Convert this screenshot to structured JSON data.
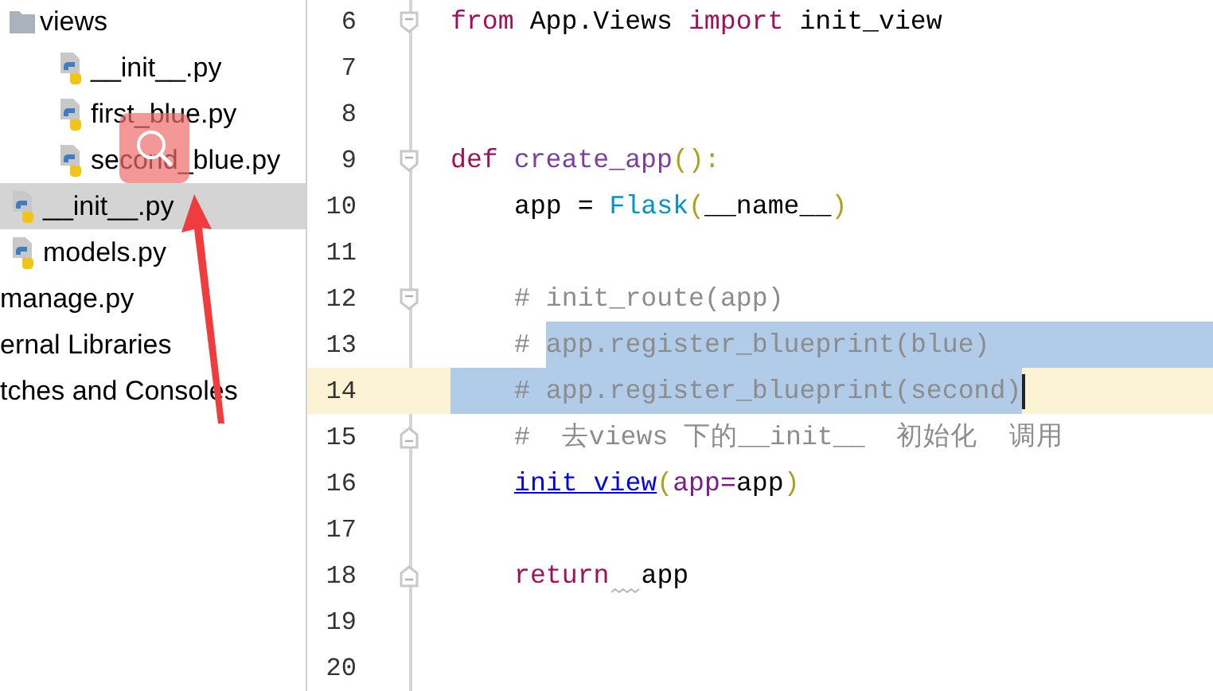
{
  "project_tree": {
    "items": [
      {
        "label": "views",
        "kind": "folder",
        "selected": false,
        "children": [
          {
            "label": "__init__.py",
            "kind": "python",
            "selected": false
          },
          {
            "label": "first_blue.py",
            "kind": "python",
            "selected": false
          },
          {
            "label": "second_blue.py",
            "kind": "python",
            "selected": false
          }
        ]
      },
      {
        "label": "__init__.py",
        "kind": "python",
        "selected": true
      },
      {
        "label": "models.py",
        "kind": "python",
        "selected": false
      }
    ],
    "outer_items": [
      {
        "label": "manage.py",
        "selected": false
      },
      {
        "label": "ernal Libraries",
        "selected": false
      },
      {
        "label": "tches and Consoles",
        "selected": false
      }
    ]
  },
  "editor": {
    "lines": [
      {
        "number": "6",
        "current": false,
        "fold_start": true,
        "fold_end": false,
        "indented": false,
        "selection_to_end": false,
        "tokens": [
          {
            "text": "from",
            "kind": "keyword",
            "selected": false,
            "warning": false
          },
          {
            "text": "App.Views",
            "kind": "plain",
            "selected": false,
            "warning": false
          },
          {
            "text": "import",
            "kind": "keyword",
            "selected": false,
            "warning": false
          },
          {
            "text": "init_view",
            "kind": "plain",
            "selected": false,
            "warning": false
          }
        ]
      },
      {
        "number": "7",
        "current": false,
        "fold_start": false,
        "fold_end": false,
        "selection_to_end": false
      },
      {
        "number": "8",
        "current": false,
        "fold_start": false,
        "fold_end": false,
        "selection_to_end": false
      },
      {
        "number": "9",
        "current": false,
        "fold_start": true,
        "fold_end": false,
        "indented": false,
        "selection_to_end": false,
        "tokens": [
          {
            "text": "def",
            "kind": "keyword",
            "selected": false,
            "warning": false
          },
          {
            "text": "create_app",
            "kind": "function",
            "selected": false,
            "warning": false
          },
          {
            "text": "():",
            "kind": "paren",
            "selected": false,
            "warning": false
          }
        ]
      },
      {
        "number": "10",
        "current": false,
        "fold_start": false,
        "fold_end": false,
        "indented": true,
        "selection_to_end": false,
        "tokens": [
          {
            "text": "app = ",
            "kind": "plain",
            "selected": false,
            "warning": false
          },
          {
            "text": "Flask",
            "kind": "builtin",
            "selected": false,
            "warning": false
          },
          {
            "text": "(",
            "kind": "paren",
            "selected": false,
            "warning": false
          },
          {
            "text": "__name__",
            "kind": "call",
            "selected": false,
            "warning": false
          },
          {
            "text": ")",
            "kind": "paren",
            "selected": false,
            "warning": false
          }
        ]
      },
      {
        "number": "11",
        "current": false,
        "fold_start": false,
        "fold_end": false,
        "selection_to_end": false
      },
      {
        "number": "12",
        "current": false,
        "fold_start": true,
        "fold_end": false,
        "indented": true,
        "selection_to_end": false,
        "tokens": [
          {
            "text": "# init_route(app)",
            "kind": "comment",
            "selected": false,
            "warning": false
          }
        ]
      },
      {
        "number": "13",
        "current": false,
        "fold_start": false,
        "fold_end": false,
        "indented": true,
        "selection_to_end": true,
        "tokens": [
          {
            "text": "# ",
            "kind": "comment",
            "selected": false,
            "warning": false
          },
          {
            "text": "app.register_blueprint(blue)",
            "kind": "comment",
            "selected": true,
            "warning": false
          }
        ]
      },
      {
        "number": "14",
        "current": true,
        "fold_start": false,
        "fold_end": false,
        "indented": true,
        "selection_to_end": false,
        "tokens": [
          {
            "text": "# app.register_blueprint(second)",
            "kind": "comment",
            "selected": true,
            "warning": false
          }
        ]
      },
      {
        "number": "15",
        "current": false,
        "fold_start": false,
        "fold_end": true,
        "indented": true,
        "selection_to_end": false,
        "tokens": [
          {
            "text": "#  去views 下的__init__  初始化  调用",
            "kind": "comment",
            "selected": false,
            "warning": false
          }
        ]
      },
      {
        "number": "16",
        "current": false,
        "fold_start": false,
        "fold_end": false,
        "indented": true,
        "selection_to_end": false,
        "tokens": [
          {
            "text": "init_view",
            "kind": "link",
            "selected": false,
            "warning": false
          },
          {
            "text": "(",
            "kind": "paren",
            "selected": false,
            "warning": false
          },
          {
            "text": "app=",
            "kind": "param",
            "selected": false,
            "warning": false
          },
          {
            "text": "app",
            "kind": "plain",
            "selected": false,
            "warning": false
          },
          {
            "text": ")",
            "kind": "paren",
            "selected": false,
            "warning": false
          }
        ]
      },
      {
        "number": "17",
        "current": false,
        "fold_start": false,
        "fold_end": false,
        "selection_to_end": false
      },
      {
        "number": "18",
        "current": false,
        "fold_start": false,
        "fold_end": true,
        "indented": true,
        "selection_to_end": false,
        "tokens": [
          {
            "text": "return",
            "kind": "keyword",
            "selected": false,
            "warning": false
          },
          {
            "text": "app",
            "kind": "plain",
            "selected": false,
            "warning": true
          }
        ]
      },
      {
        "number": "19",
        "current": false,
        "fold_start": false,
        "fold_end": false,
        "selection_to_end": false
      },
      {
        "number": "20",
        "current": false,
        "fold_start": false,
        "fold_end": false,
        "selection_to_end": false
      }
    ]
  }
}
